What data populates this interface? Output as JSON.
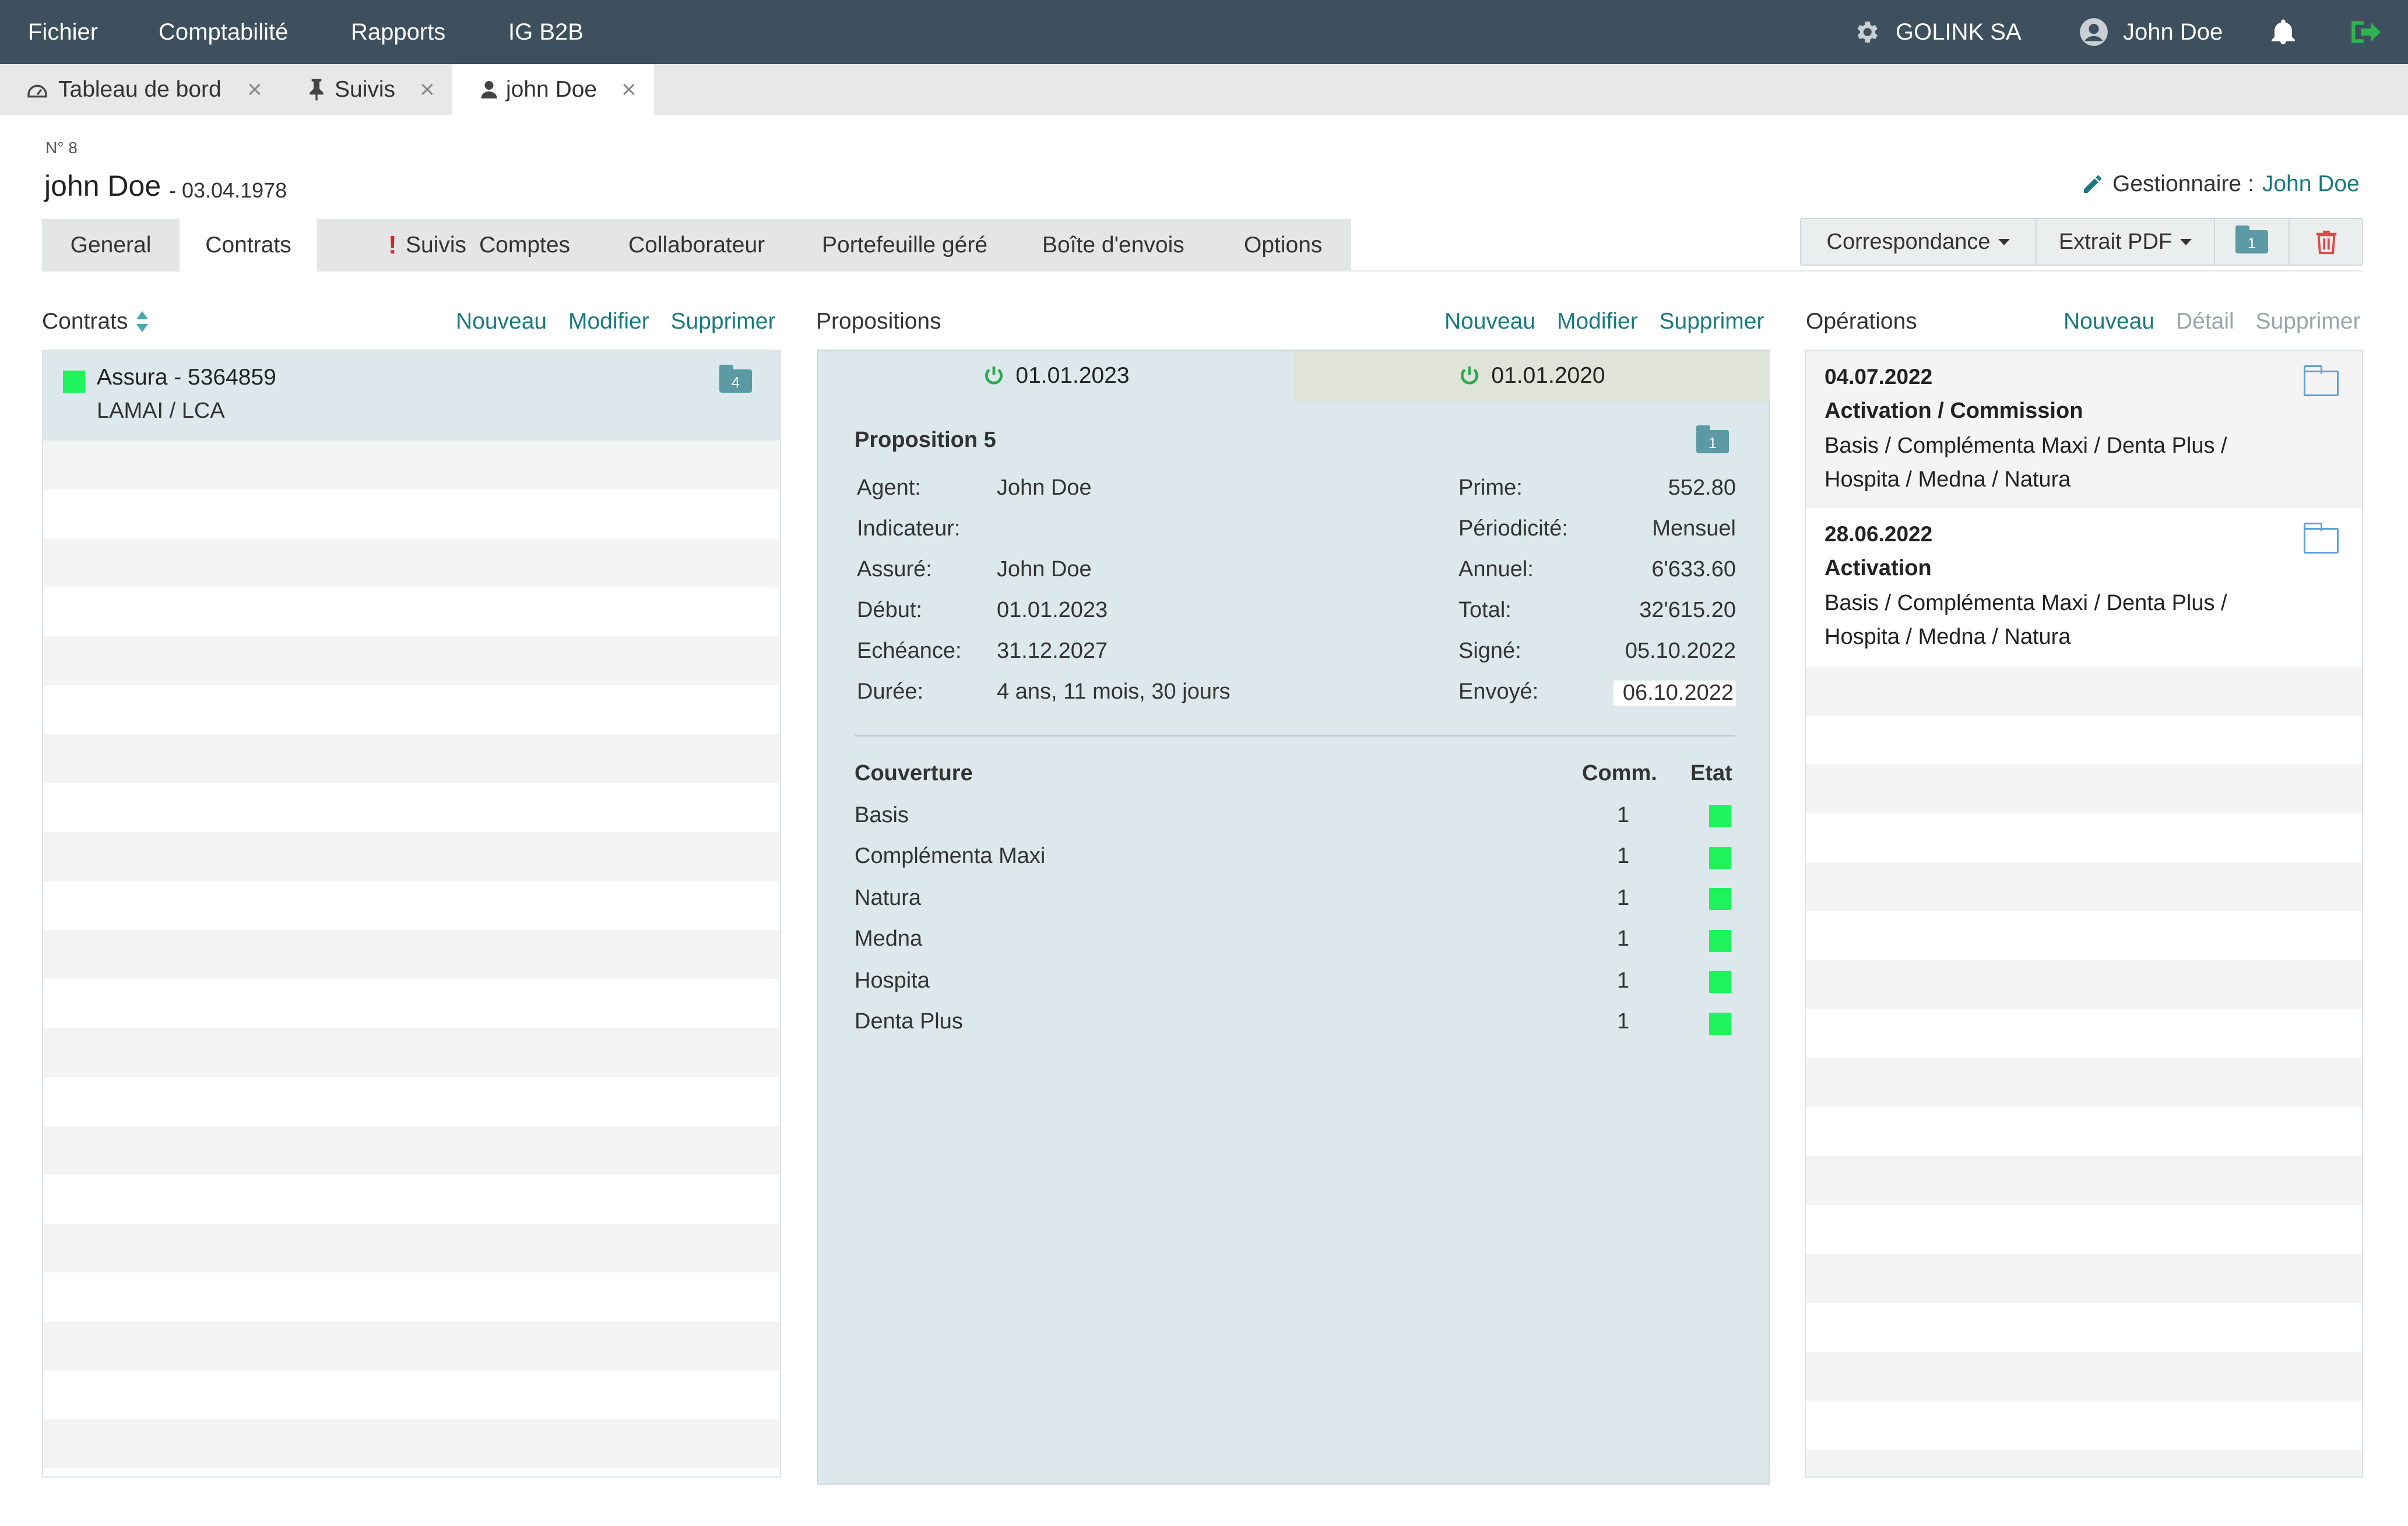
{
  "topbar": {
    "menus": [
      "Fichier",
      "Comptabilité",
      "Rapports",
      "IG B2B"
    ],
    "company": "GOLINK SA",
    "user": "John Doe"
  },
  "doc_tabs": [
    {
      "label": "Tableau de bord",
      "icon": "dashboard-icon"
    },
    {
      "label": "Suivis",
      "icon": "pin-icon"
    },
    {
      "label": "john Doe",
      "icon": "user-icon",
      "active": true
    }
  ],
  "header": {
    "number": "N° 8",
    "name": "john Doe",
    "birthdate": "- 03.04.1978",
    "manager_label": "Gestionnaire :",
    "manager_name": "John Doe"
  },
  "section_tabs": [
    "General",
    "Contrats",
    "Suivis",
    "Comptes",
    "Collaborateur",
    "Portefeuille géré",
    "Boîte d'envois",
    "Options"
  ],
  "section_active": "Contrats",
  "actions": {
    "correspondance": "Correspondance",
    "extrait": "Extrait PDF",
    "folder_count": "1"
  },
  "contracts": {
    "title": "Contrats",
    "links": [
      "Nouveau",
      "Modifier",
      "Supprimer"
    ],
    "items": [
      {
        "name": "Assura - 5364859",
        "sub": "LAMAI / LCA",
        "count": "4",
        "status_color": "#1ef35c"
      }
    ]
  },
  "propositions": {
    "title": "Propositions",
    "links": [
      "Nouveau",
      "Modifier",
      "Supprimer"
    ],
    "tabs": [
      "01.01.2023",
      "01.01.2020"
    ],
    "heading": "Proposition 5",
    "folder_count": "1",
    "left": [
      {
        "label": "Agent:",
        "value": "John Doe"
      },
      {
        "label": "Indicateur:",
        "value": ""
      },
      {
        "label": "Assuré:",
        "value": "John Doe"
      },
      {
        "label": "Début:",
        "value": "01.01.2023"
      },
      {
        "label": "Echéance:",
        "value": "31.12.2027"
      },
      {
        "label": "Durée:",
        "value": "4 ans, 11 mois, 30 jours"
      }
    ],
    "right": [
      {
        "label": "Prime:",
        "value": "552.80"
      },
      {
        "label": "Périodicité:",
        "value": "Mensuel"
      },
      {
        "label": "Annuel:",
        "value": "6'633.60"
      },
      {
        "label": "Total:",
        "value": "32'615.20"
      },
      {
        "label": "Signé:",
        "value": "05.10.2022"
      },
      {
        "label": "Envoyé:",
        "value": "06.10.2022"
      }
    ],
    "coverage_header": {
      "name": "Couverture",
      "comm": "Comm.",
      "state": "Etat"
    },
    "coverage": [
      {
        "name": "Basis",
        "comm": "1"
      },
      {
        "name": "Complémenta Maxi",
        "comm": "1"
      },
      {
        "name": "Natura",
        "comm": "1"
      },
      {
        "name": "Medna",
        "comm": "1"
      },
      {
        "name": "Hospita",
        "comm": "1"
      },
      {
        "name": "Denta Plus",
        "comm": "1"
      }
    ],
    "state_color": "#1ef35c"
  },
  "operations": {
    "title": "Opérations",
    "links": [
      "Nouveau",
      "Détail",
      "Supprimer"
    ],
    "items": [
      {
        "date": "04.07.2022",
        "title": "Activation / Commission",
        "line1": "Basis / Complémenta Maxi / Denta Plus /",
        "line2": "Hospita / Medna / Natura"
      },
      {
        "date": "28.06.2022",
        "title": "Activation",
        "line1": "Basis / Complémenta Maxi / Denta Plus /",
        "line2": "Hospita / Medna / Natura"
      }
    ]
  },
  "colors": {
    "topbar": "#3e4f5d",
    "link": "#197a80",
    "panel_blue": "#dce8ec",
    "status_green": "#1ef35c",
    "power_green": "#2fa84f"
  }
}
